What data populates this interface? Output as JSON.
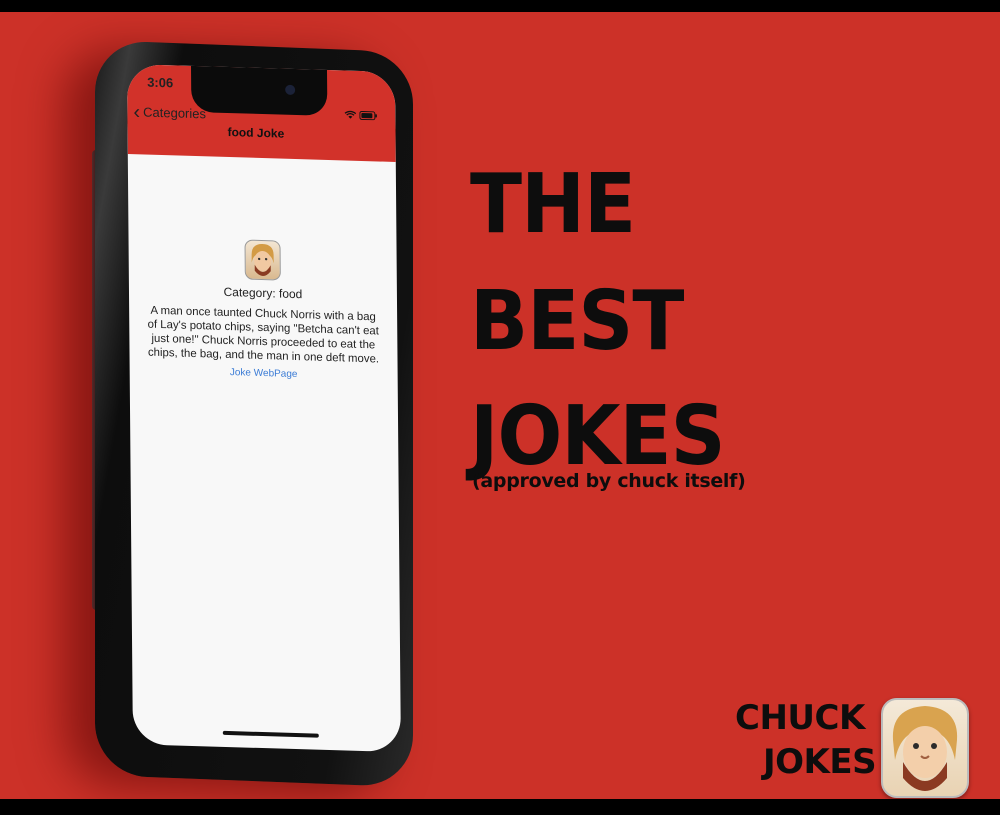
{
  "phone": {
    "status_time": "3:06",
    "status_icons": "wifi-signal, battery",
    "back_label": "Categories",
    "nav_title": "food Joke",
    "category_text": "Category: food",
    "joke_text": "A man once taunted Chuck Norris with a bag of Lay's potato chips, saying \"Betcha can't eat just one!\" Chuck Norris proceeded to eat the chips, the bag, and the man in one deft move.",
    "link_text": "Joke WebPage",
    "icons": [
      "chevron-left-icon",
      "wifi-icon",
      "battery-icon",
      "chuck-avatar-icon"
    ]
  },
  "headline": {
    "line1": "THE",
    "line2": "BEST",
    "line3": "JOKES",
    "subtitle": "(approved by chuck itself)"
  },
  "brand": {
    "line1": "CHUCK",
    "line2": "JOKES",
    "icon": "chuck-app-icon"
  },
  "colors": {
    "background": "#cc3128",
    "navbar": "#d2322a",
    "link": "#3a7bd5",
    "text": "#0d0d0d"
  }
}
